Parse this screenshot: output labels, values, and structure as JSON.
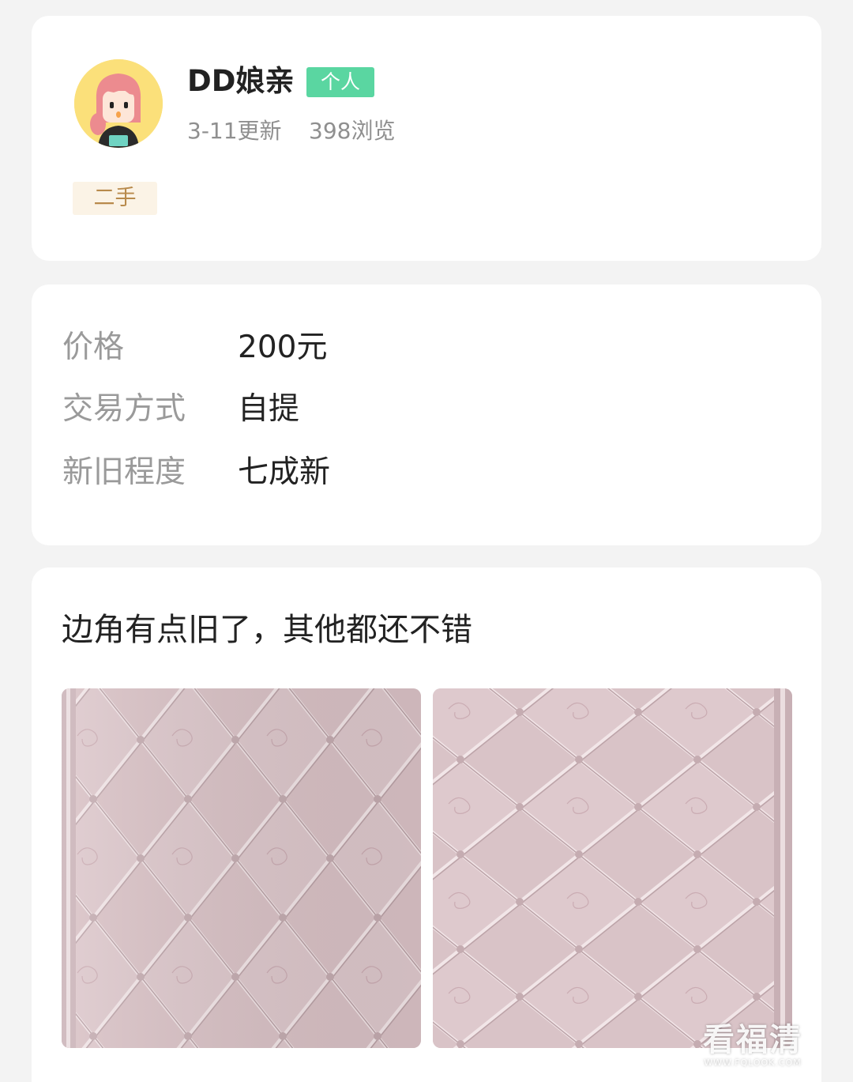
{
  "user": {
    "name": "DD娘亲",
    "badge": "个人",
    "updated": "3-11更新",
    "views": "398浏览",
    "tag": "二手"
  },
  "info": [
    {
      "label": "价格",
      "value": "200元"
    },
    {
      "label": "交易方式",
      "value": "自提"
    },
    {
      "label": "新旧程度",
      "value": "七成新"
    }
  ],
  "description": "边角有点旧了，其他都还不错",
  "photos": [
    {
      "icon": "mattress-photo"
    },
    {
      "icon": "mattress-photo"
    }
  ],
  "watermark": {
    "main": "看福清",
    "sub": "WWW.FQLOOK.COM"
  },
  "colors": {
    "badge_green": "#5ad6a1",
    "tag_bg": "#fbf3e6",
    "tag_text": "#b88a4c",
    "avatar_bg": "#fbe07a"
  }
}
